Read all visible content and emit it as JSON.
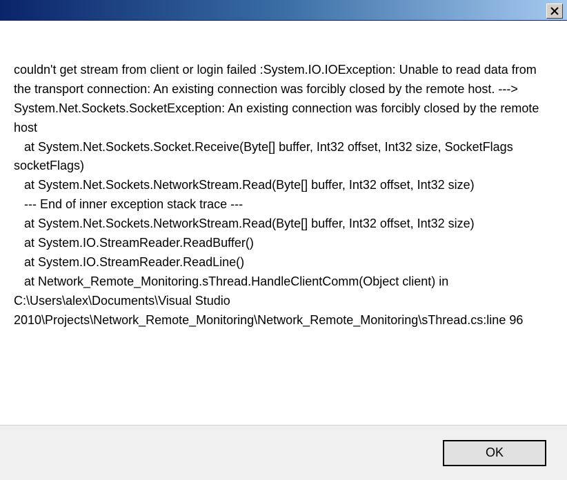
{
  "titlebar": {
    "close_label": "Close"
  },
  "error": {
    "lines": [
      "couldn't get stream from client or login failed :System.IO.IOException: Unable to read data from the transport connection: An existing connection was forcibly closed by the remote host. ---> System.Net.Sockets.SocketException: An existing connection was forcibly closed by the remote host",
      "   at System.Net.Sockets.Socket.Receive(Byte[] buffer, Int32 offset, Int32 size, SocketFlags socketFlags)",
      "   at System.Net.Sockets.NetworkStream.Read(Byte[] buffer, Int32 offset, Int32 size)",
      "   --- End of inner exception stack trace ---",
      "   at System.Net.Sockets.NetworkStream.Read(Byte[] buffer, Int32 offset, Int32 size)",
      "   at System.IO.StreamReader.ReadBuffer()",
      "   at System.IO.StreamReader.ReadLine()",
      "   at Network_Remote_Monitoring.sThread.HandleClientComm(Object client) in C:\\Users\\alex\\Documents\\Visual Studio 2010\\Projects\\Network_Remote_Monitoring\\Network_Remote_Monitoring\\sThread.cs:line 96"
    ]
  },
  "buttons": {
    "ok_label": "OK"
  }
}
